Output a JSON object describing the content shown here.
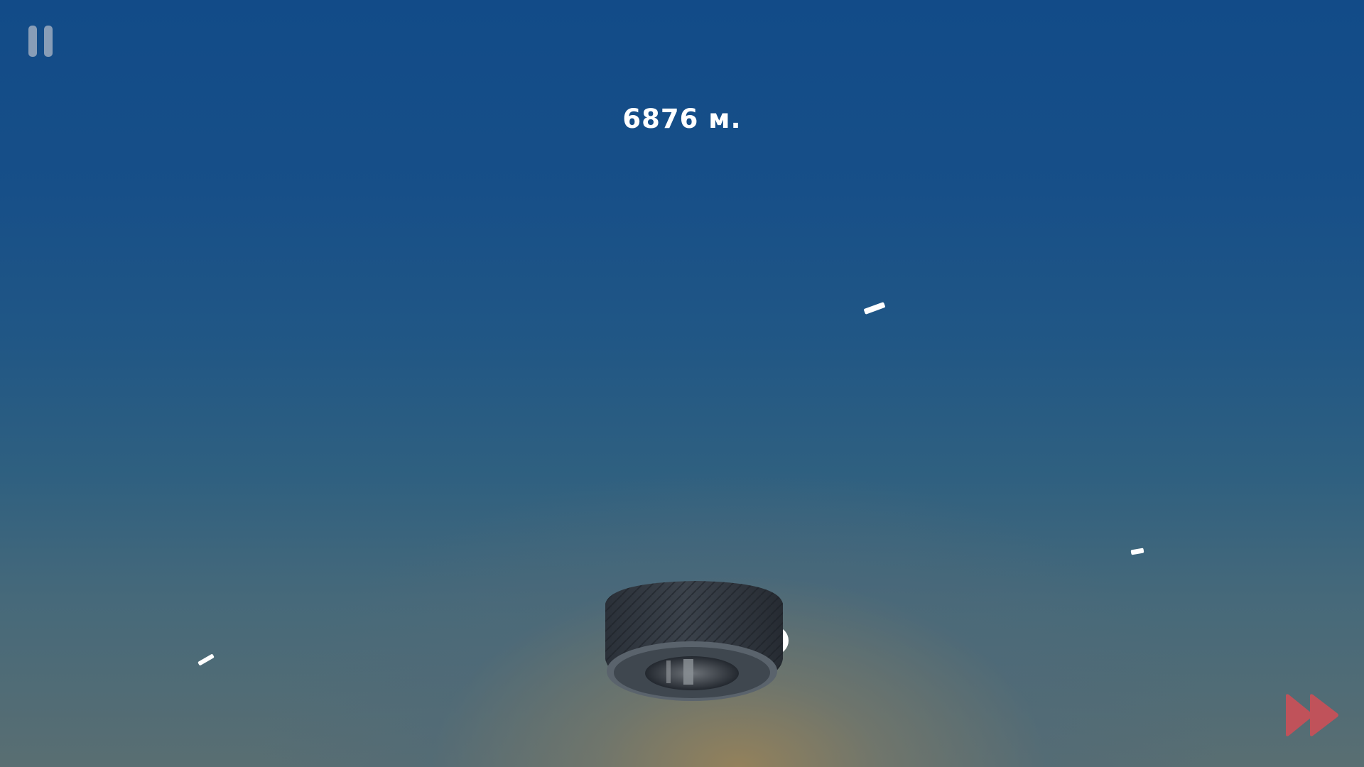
{
  "hud": {
    "distance_text": "6876 м."
  },
  "icons": {
    "pause": "pause-icon",
    "fast_forward": "fast-forward-icon"
  },
  "colors": {
    "sky_top": "#124b88",
    "sky_bottom": "#596e72",
    "horizon_glow": "#968259",
    "pause_icon": "#9eabc0",
    "fast_forward_icon": "#c0525a",
    "distance_text": "#ffffff"
  }
}
